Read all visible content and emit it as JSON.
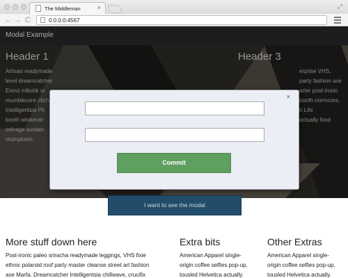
{
  "browser": {
    "tab_title": "The Middleman",
    "tab_close": "×",
    "url": "0.0.0.0:4567",
    "back": "←",
    "forward": "→",
    "reload": "C",
    "fullscreen": "⤢"
  },
  "navbar": {
    "brand": "Modal Example"
  },
  "hero": {
    "columns": [
      {
        "heading": "Header 1",
        "lines": [
          "Artisan readymade",
          "level dreamcatcher",
          "Ennui mlkshk or",
          "mumblecore clich",
          "Intelligentsia Pit",
          "booth whatever",
          "selvage sustain",
          "stumptown."
        ]
      },
      {
        "heading": "",
        "lines": [
          "",
          "",
          "",
          "",
          "",
          "",
          "",
          ""
        ]
      },
      {
        "heading": "Header 3",
        "lines": [
          "erprise VHS,",
          "party fashion axe",
          "arter post-ironic",
          "booth normcore,",
          "h Life",
          "actually food",
          "",
          ""
        ]
      }
    ],
    "button_label": "I want to see the modal"
  },
  "lower": {
    "columns": [
      {
        "heading": "More stuff down here",
        "lines": [
          "Post-ironic paleo sriracha readymade leggings, VHS fixie",
          "ethnic polaroid roof party master cleanse street art fashion",
          "axe Marfa. Dreamcatcher Intelligentsia chillwave, crucifix"
        ]
      },
      {
        "heading": "Extra bits",
        "lines": [
          "American Apparel single-",
          "origin coffee selfies pop-up,",
          "tousled Helvetica actually."
        ]
      },
      {
        "heading": "Other Extras",
        "lines": [
          "American Apparel single-",
          "origin coffee selfies pop-up,",
          "tousled Helvetica actually."
        ]
      }
    ]
  },
  "modal": {
    "close_label": "×",
    "input1": {
      "value": "",
      "placeholder": ""
    },
    "input2": {
      "value": "",
      "placeholder": ""
    },
    "commit_label": "Commit"
  },
  "colors": {
    "navbar_bg": "#1d1d1d",
    "commit_green": "#5f9f5f",
    "cta_blue": "#214d6b",
    "modal_bg": "#eceef5",
    "close_blue": "#2e4d86"
  }
}
